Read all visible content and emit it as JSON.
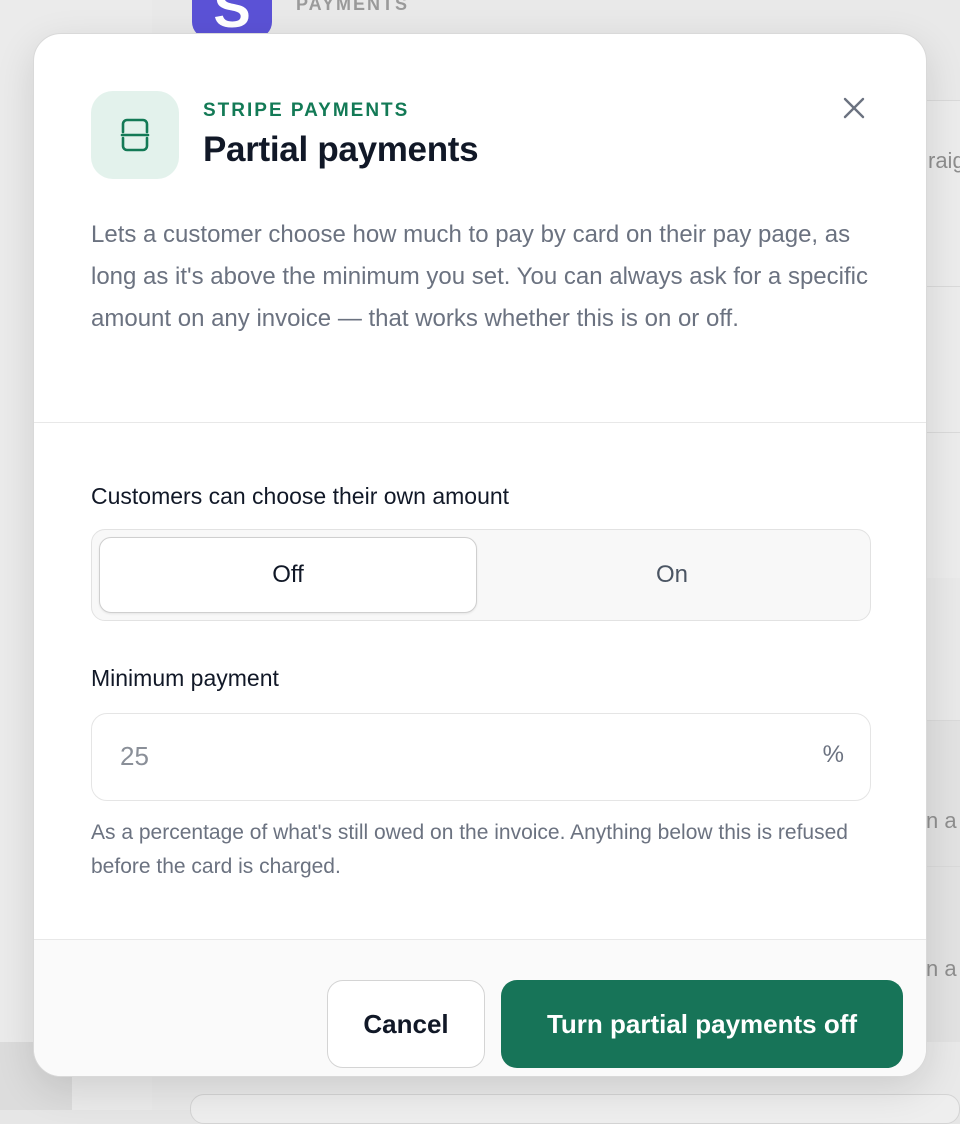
{
  "background": {
    "app_label": "PAYMENTS",
    "app_icon_letter": "S",
    "fragments": [
      "raig",
      "n a",
      "n a"
    ]
  },
  "modal": {
    "eyebrow": "STRIPE PAYMENTS",
    "title": "Partial payments",
    "description": "Lets a customer choose how much to pay by card on their pay page, as long as it's above the minimum you set. You can always ask for a specific amount on any invoice — that works whether this is on or off.",
    "choose_label": "Customers can choose their own amount",
    "toggle": {
      "off_label": "Off",
      "on_label": "On",
      "selected": "Off"
    },
    "minimum": {
      "label": "Minimum payment",
      "placeholder": "25",
      "value": "",
      "unit": "%",
      "helper": "As a percentage of what's still owed on the invoice. Anything below this is refused before the card is charged."
    },
    "buttons": {
      "cancel": "Cancel",
      "primary": "Turn partial payments off"
    }
  },
  "colors": {
    "accent": "#137a56",
    "primary_button": "#177458",
    "icon_bg": "#e3f2ec"
  },
  "icons": {
    "header": "toggle-split-icon",
    "close": "close-icon"
  }
}
